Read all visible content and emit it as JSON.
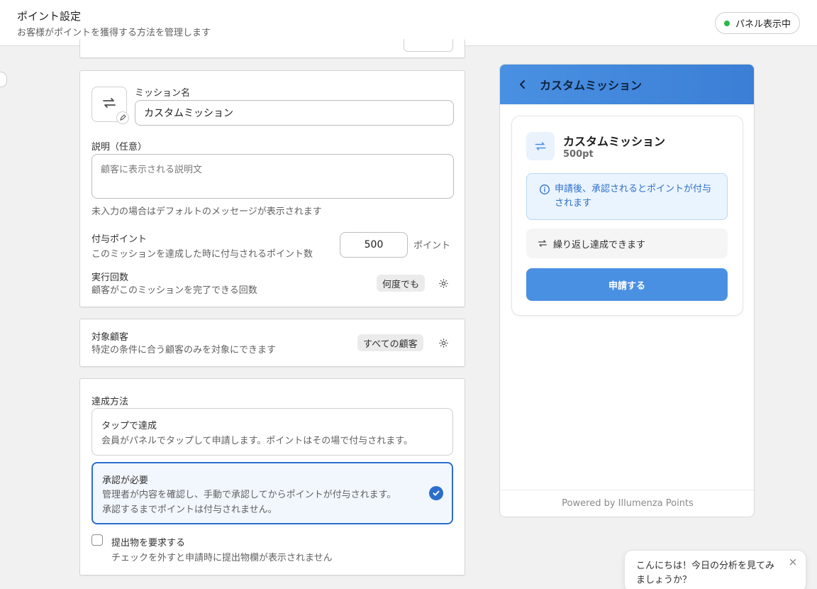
{
  "header": {
    "title": "ポイント設定",
    "subtitle": "お客様がポイントを獲得する方法を管理します",
    "status_label": "パネル表示中"
  },
  "mission": {
    "name_label": "ミッション名",
    "name_value": "カスタムミッション",
    "desc_label": "説明（任意）",
    "desc_placeholder": "顧客に表示される説明文",
    "desc_help": "未入力の場合はデフォルトのメッセージが表示されます",
    "points_label": "付与ポイント",
    "points_help": "このミッションを達成した時に付与されるポイント数",
    "points_value": "500",
    "points_unit": "ポイント",
    "runs_label": "実行回数",
    "runs_help": "顧客がこのミッションを完了できる回数",
    "runs_value": "何度でも"
  },
  "target": {
    "label": "対象顧客",
    "help": "特定の条件に合う顧客のみを対象にできます",
    "value": "すべての顧客"
  },
  "method": {
    "label": "達成方法",
    "options": [
      {
        "title": "タップで達成",
        "desc": "会員がパネルでタップして申請します。ポイントはその場で付与されます。",
        "selected": false
      },
      {
        "title": "承認が必要",
        "desc": "管理者が内容を確認し、手動で承認してからポイントが付与されます。",
        "desc2": "承認するまでポイントは付与されません。",
        "selected": true
      }
    ],
    "submission_label": "提出物を要求する",
    "submission_help": "チェックを外すと申請時に提出物欄が表示されません",
    "submission_checked": false
  },
  "preview": {
    "header_title": "カスタムミッション",
    "mission_name": "カスタムミッション",
    "mission_points": "500pt",
    "info_text": "申請後、承認されるとポイントが付与されます",
    "repeat_text": "繰り返し達成できます",
    "apply_label": "申請する",
    "footer": "Powered by Illumenza Points"
  },
  "chat": {
    "message": "こんにちは！今日の分析を見てみましょうか？"
  },
  "colors": {
    "accent": "#2c6ecb",
    "preview_header": "#4a90e2",
    "status_dot": "#29b84a"
  }
}
